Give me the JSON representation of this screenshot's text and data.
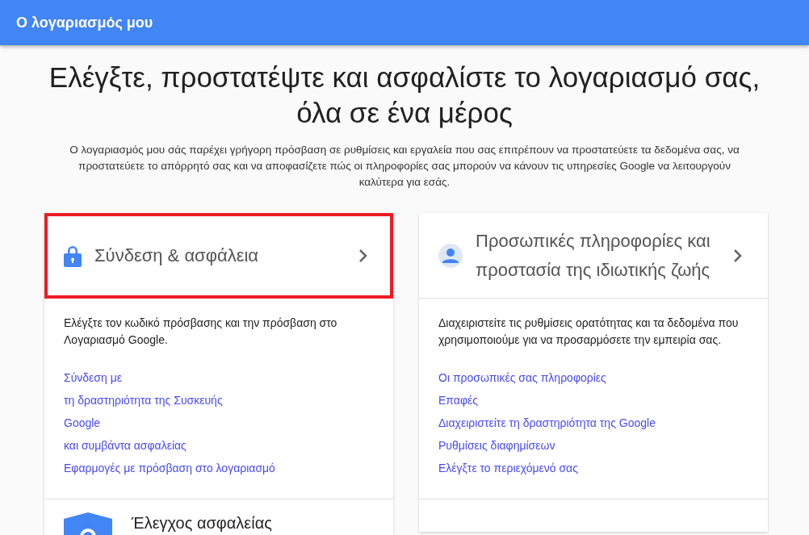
{
  "header": {
    "title": "Ο λογαριασμός μου"
  },
  "hero": {
    "title": "Ελέγξτε, προστατέψτε και ασφαλίστε το λογαριασμό σας, όλα σε ένα μέρος",
    "intro": "Ο λογαριασμός μου σάς παρέχει γρήγορη πρόσβαση σε ρυθμίσεις και εργαλεία που σας επιτρέπουν να προστατεύετε τα δεδομένα σας, να προστατεύετε το απόρρητό σας και να αποφασίζετε πώς οι πληροφορίες σας μπορούν να κάνουν τις υπηρεσίες Google να λειτουργούν καλύτερα για εσάς."
  },
  "cards": [
    {
      "kind": "lock",
      "title": "Σύνδεση & ασφάλεια",
      "highlighted": true,
      "description": "Ελέγξτε τον κωδικό πρόσβασης και την πρόσβαση στο Λογαριασμό Google.",
      "links": [
        "Σύνδεση με",
        "τη δραστηριότητα της Συσκευής",
        "Google",
        "και συμβάντα ασφαλείας",
        "Εφαρμογές με πρόσβαση στο λογαριασμό"
      ],
      "footer": {
        "kind": "shield",
        "title": "Έλεγχος ασφαλείας"
      }
    },
    {
      "kind": "person",
      "title": "Προσωπικές πληροφορίες και προστασία της ιδιωτικής ζωής",
      "highlighted": false,
      "description": "Διαχειριστείτε τις ρυθμίσεις ορατότητας και τα δεδομένα που χρησιμοποιούμε για να προσαρμόσετε την εμπειρία σας.",
      "links": [
        "Οι προσωπικές σας πληροφορίες",
        "Επαφές",
        "Διαχειριστείτε τη δραστηριότητα της Google",
        "Ρυθμίσεις διαφημίσεων",
        "Ελέγξτε το περιεχόμενό σας"
      ]
    }
  ]
}
